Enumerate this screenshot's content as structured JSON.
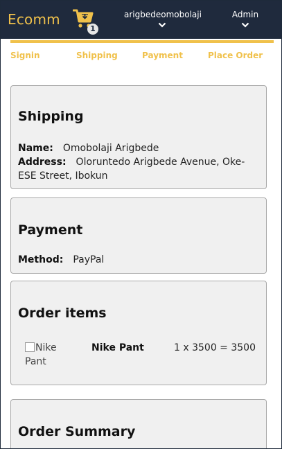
{
  "header": {
    "brand": "Ecomm",
    "cart_count": "1",
    "user_name": "arigbedeomobolaji",
    "admin_label": "Admin"
  },
  "steps": [
    "Signin",
    "Shipping",
    "Payment",
    "Place Order"
  ],
  "shipping": {
    "title": "Shipping",
    "name_label": "Name:",
    "name_value": "Omobolaji Arigbede",
    "address_label": "Address:",
    "address_value": "Oloruntedo Arigbede Avenue, Oke-ESE Street, Ibokun"
  },
  "payment": {
    "title": "Payment",
    "method_label": "Method:",
    "method_value": "PayPal"
  },
  "order_items": {
    "title": "Order items",
    "items": [
      {
        "image_alt": "Nike Pant",
        "name": "Nike Pant",
        "calc": "1 x 3500 = 3500"
      }
    ]
  },
  "summary": {
    "title": "Order Summary"
  },
  "colors": {
    "navbar": "#1f2a3d",
    "accent": "#f0c14b",
    "card_bg": "#f0f0f0"
  }
}
